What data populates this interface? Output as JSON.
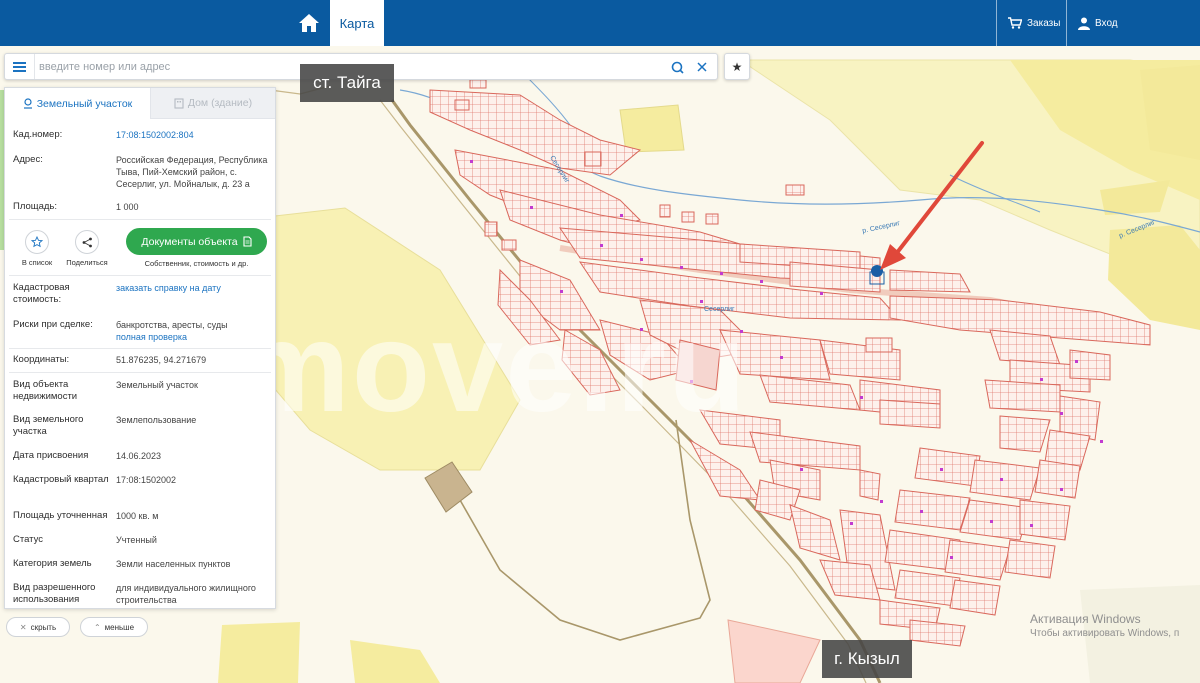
{
  "topbar": {
    "home_icon": "home-icon",
    "active_tab": "Карта",
    "orders_label": "Заказы",
    "login_label": "Вход",
    "bg_color": "#0a5aa0"
  },
  "search": {
    "placeholder": "введите номер или адрес",
    "value": ""
  },
  "panel": {
    "tabs": [
      {
        "label": "Земельный участок",
        "active": true
      },
      {
        "label": "Дом (здание)",
        "active": false
      }
    ],
    "rows_top": [
      {
        "label": "Кад.номер:",
        "value": "17:08:1502002:804"
      },
      {
        "label": "Адрес:",
        "value": "Российская Федерация, Республика Тыва, Пий-Хемский район, с. Сесерлиг, ул. Мойналык, д. 23 а"
      },
      {
        "label": "Площадь:",
        "value": "1 000"
      }
    ],
    "actions": {
      "to_list": "В список",
      "share": "Поделиться",
      "documents": "Документы объекта",
      "documents_sub": "Собственник, стоимость и др."
    },
    "cadastral_cost": {
      "label": "Кадастровая стоимость:",
      "link": "заказать справку на дату"
    },
    "risks": {
      "label": "Риски при сделке:",
      "value": "банкротства, аресты, суды",
      "link": "полная проверка"
    },
    "coords": {
      "label": "Координаты:",
      "value": "51.876235, 94.271679"
    },
    "details": [
      {
        "label": "Вид объекта недвижимости",
        "value": "Земельный участок"
      },
      {
        "label": "Вид земельного участка",
        "value": "Землепользование"
      },
      {
        "label": "Дата присвоения",
        "value": "14.06.2023"
      },
      {
        "label": "Кадастровый квартал",
        "value": "17:08:1502002"
      },
      {
        "label": "Площадь уточненная",
        "value": "1000 кв. м"
      },
      {
        "label": "Статус",
        "value": "Учтенный"
      },
      {
        "label": "Категория земель",
        "value": "Земли населенных пунктов"
      },
      {
        "label": "Вид разрешенного использования",
        "value": "для индивидуального жилищного строительства"
      }
    ],
    "hide_label": "скрыть",
    "less_label": "меньше"
  },
  "map": {
    "label_taiga": "ст. Тайга",
    "label_kyzyl": "г. Кызыл",
    "watermark": "move.ru",
    "street_labels": [
      "Сесерлиг",
      "р. Сесерлиг",
      "р. Сесерлиг",
      "Сесерлиг"
    ],
    "win_activation_title": "Активация Windows",
    "win_activation_text": "Чтобы активировать Windows, п",
    "marker_color": "#1a5ea5",
    "arrow_color": "#e0483a",
    "parcel_color": "#e07a70"
  }
}
